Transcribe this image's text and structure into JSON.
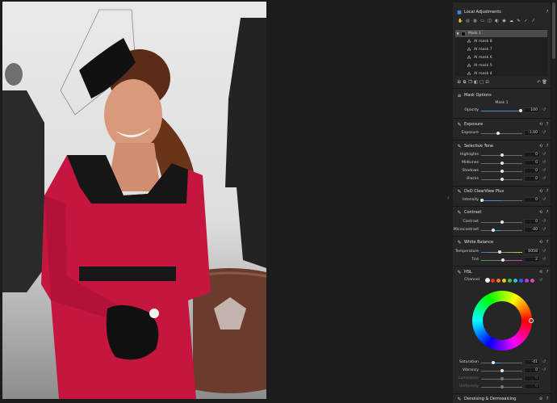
{
  "local_adjustments": {
    "title": "Local Adjustments",
    "masks": [
      {
        "name": "Mask 1",
        "selected": true
      },
      {
        "name": "AI mask 8",
        "selected": false
      },
      {
        "name": "AI mask 7",
        "selected": false
      },
      {
        "name": "AI mask 6",
        "selected": false
      },
      {
        "name": "AI mask 5",
        "selected": false
      },
      {
        "name": "AI mask 4",
        "selected": false
      }
    ]
  },
  "mask_options": {
    "title": "Mask Options",
    "mask_name": "Mask 1",
    "opacity": {
      "label": "Opacity",
      "value": "100",
      "fraction": 0.97
    }
  },
  "exposure": {
    "title": "Exposure",
    "exposure": {
      "label": "Exposure",
      "value": "-1.00",
      "fraction": 0.42
    }
  },
  "selective_tone": {
    "title": "Selective Tone",
    "highlights": {
      "label": "Highlights",
      "value": "0",
      "fraction": 0.5
    },
    "midtones": {
      "label": "Midtones",
      "value": "0",
      "fraction": 0.5
    },
    "shadows": {
      "label": "Shadows",
      "value": "0",
      "fraction": 0.5
    },
    "blacks": {
      "label": "Blacks",
      "value": "0",
      "fraction": 0.5
    }
  },
  "clearview": {
    "title": "DxO ClearView Plus",
    "intensity": {
      "label": "Intensity",
      "value": "0",
      "fraction": 0.02
    }
  },
  "contrast": {
    "title": "Contrast",
    "contrast": {
      "label": "Contrast",
      "value": "0",
      "fraction": 0.5
    },
    "microcontrast": {
      "label": "Microcontrast",
      "value": "-40",
      "fraction": 0.3
    }
  },
  "white_balance": {
    "title": "White Balance",
    "temperature": {
      "label": "Temperature",
      "value": "6058",
      "fraction": 0.45
    },
    "tint": {
      "label": "Tint",
      "value": "2",
      "fraction": 0.52
    }
  },
  "hsl": {
    "title": "HSL",
    "channel_label": "Channel",
    "swatch_colors": [
      "#f0f0f0",
      "#e03030",
      "#f07a20",
      "#e8c820",
      "#40c040",
      "#30c0c0",
      "#3060e0",
      "#a040e0",
      "#e040c0"
    ],
    "saturation": {
      "label": "Saturation",
      "value": "-41",
      "fraction": 0.3
    },
    "vibrancy": {
      "label": "Vibrancy",
      "value": "0",
      "fraction": 0.5
    },
    "luminance": {
      "label": "Luminance",
      "value": "0",
      "fraction": 0.5
    },
    "uniformity": {
      "label": "Uniformity",
      "value": "0",
      "fraction": 0.5
    }
  },
  "denoising": {
    "title": "Denoising & Demosaicing"
  },
  "icons": {
    "section": "pencil-icon",
    "help": "question-icon",
    "undo": "undo-icon",
    "reset": "reset-icon"
  },
  "colors": {
    "accent": "#3d8de0",
    "panel": "#262626",
    "background": "#1c1c1c"
  }
}
